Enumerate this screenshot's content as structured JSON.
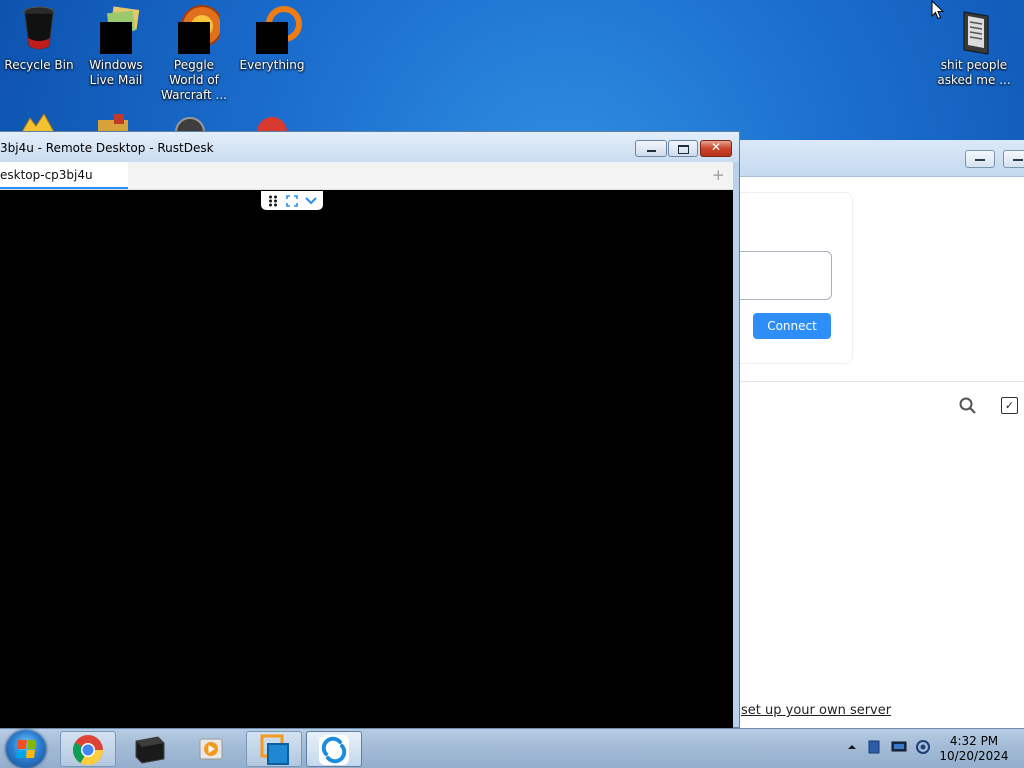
{
  "desktop": {
    "icons": [
      {
        "label": "Recycle Bin",
        "icon": "recycle-bin-icon"
      },
      {
        "label": "Windows Live Mail",
        "icon": "windows-live-mail-icon"
      },
      {
        "label": "Peggle World of Warcraft ...",
        "icon": "peggle-icon"
      },
      {
        "label": "Everything",
        "icon": "everything-search-icon"
      },
      {
        "label": "shit people asked me ...",
        "icon": "folder-icon"
      }
    ]
  },
  "remote_window": {
    "title": "3bj4u - Remote Desktop - RustDesk",
    "tab_label": "esktop-cp3bj4u",
    "add_tab": "+"
  },
  "main_window": {
    "connect_label": "Connect",
    "server_link": "set up your own server"
  },
  "taskbar": {
    "apps": [
      "chrome-icon",
      "terminal-icon",
      "media-player-icon",
      "vmware-icon",
      "rustdesk-icon"
    ],
    "clock_time": "4:32 PM",
    "clock_date": "10/20/2024"
  },
  "colors": {
    "accent": "#2e8ef8",
    "desktop": "#1c6fcf"
  }
}
